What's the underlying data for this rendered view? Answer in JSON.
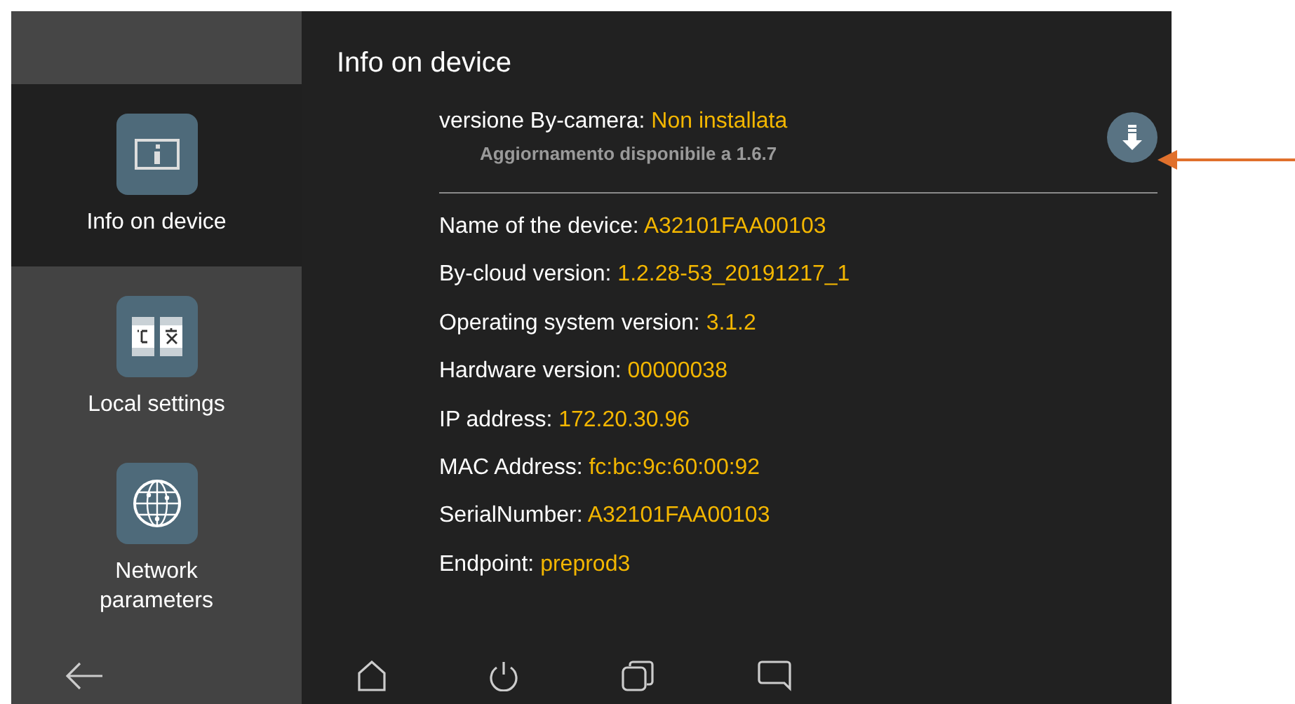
{
  "sidebar": {
    "items": [
      {
        "kind": "info",
        "label": "Info on device",
        "selected": true
      },
      {
        "kind": "local",
        "label": "Local settings",
        "selected": false
      },
      {
        "kind": "network",
        "label": "Network parameters",
        "selected": false
      }
    ]
  },
  "content": {
    "title": "Info on device",
    "camera_version": {
      "label": "versione By-camera:",
      "value": "Non installata",
      "update_note": "Aggiornamento disponibile a 1.6.7"
    },
    "rows": [
      {
        "label": "Name of the device:",
        "value": "A32101FAA00103"
      },
      {
        "label": "By-cloud version:",
        "value": "1.2.28-53_20191217_1"
      },
      {
        "label": "Operating system version:",
        "value": "3.1.2"
      },
      {
        "label": "Hardware version:",
        "value": "00000038"
      },
      {
        "label": "IP address:",
        "value": "172.20.30.96"
      },
      {
        "label": "MAC Address:",
        "value": "fc:bc:9c:60:00:92"
      },
      {
        "label": "SerialNumber:",
        "value": "A32101FAA00103"
      },
      {
        "label": "Endpoint:",
        "value": "preprod3"
      }
    ]
  }
}
